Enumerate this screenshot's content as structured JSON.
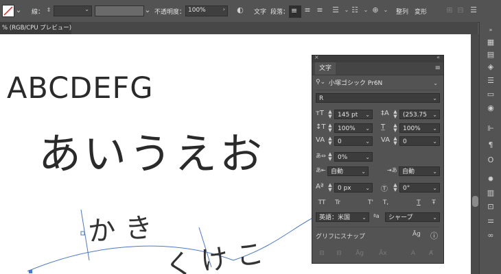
{
  "control_bar": {
    "stroke_label": "線：",
    "opacity_label": "不透明度：",
    "opacity_value": "100%",
    "character_label": "文字",
    "paragraph_label": "段落：",
    "align_label": "整列",
    "transform_label": "変形"
  },
  "document_tab": {
    "title": "% (RGB/CPU プレビュー)"
  },
  "canvas": {
    "text_latin": "ABCDEFG",
    "text_hiragana": "あいうえお",
    "path_text_1": "かき",
    "path_text_2": "くけこ"
  },
  "character_panel": {
    "tab_label": "文字",
    "font_family": "小塚ゴシック Pr6N",
    "font_style": "R",
    "font_size": "145 pt",
    "leading": "(253.75",
    "vertical_scale": "100%",
    "horizontal_scale": "100%",
    "kerning": "0",
    "tracking": "0",
    "tsume": "0%",
    "aki_left": "自動",
    "aki_right": "自動",
    "baseline_shift": "0 px",
    "rotation": "0°",
    "language": "英語：米国",
    "antialias": "シャープ",
    "snap_label": "グリフにスナップ",
    "style_buttons": [
      "TT",
      "Tr",
      "T'",
      "T,",
      "T",
      "Ŧ"
    ]
  },
  "colors": {
    "ui_bg": "#535353",
    "canvas": "#ffffff",
    "path": "#4a78c8"
  }
}
